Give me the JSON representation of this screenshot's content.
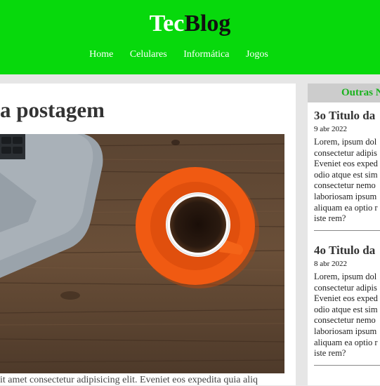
{
  "site": {
    "logo_part1": "Tec",
    "logo_part2": "Blog",
    "nav": [
      "Home",
      "Celulares",
      "Informática",
      "Jogos"
    ]
  },
  "post": {
    "title": "a postagem",
    "text": "it amet consectetur adipisicing elit. Eveniet eos expedita quia aliq"
  },
  "sidebar": {
    "heading": "Outras N",
    "articles": [
      {
        "title": "3o Titulo da",
        "date": "9 abr 2022",
        "excerpt": [
          "Lorem, ipsum dol",
          "consectetur adipis",
          "Eveniet eos exped",
          "odio atque est sim",
          "consectetur nemo",
          "laboriosam ipsum",
          "aliquam ea optio r",
          "iste rem?"
        ]
      },
      {
        "title": "4o Titulo da",
        "date": "8 abr 2022",
        "excerpt": [
          "Lorem, ipsum dol",
          "consectetur adipis",
          "Eveniet eos exped",
          "odio atque est sim",
          "consectetur nemo",
          "laboriosam ipsum",
          "aliquam ea optio r",
          "iste rem?"
        ]
      }
    ]
  }
}
